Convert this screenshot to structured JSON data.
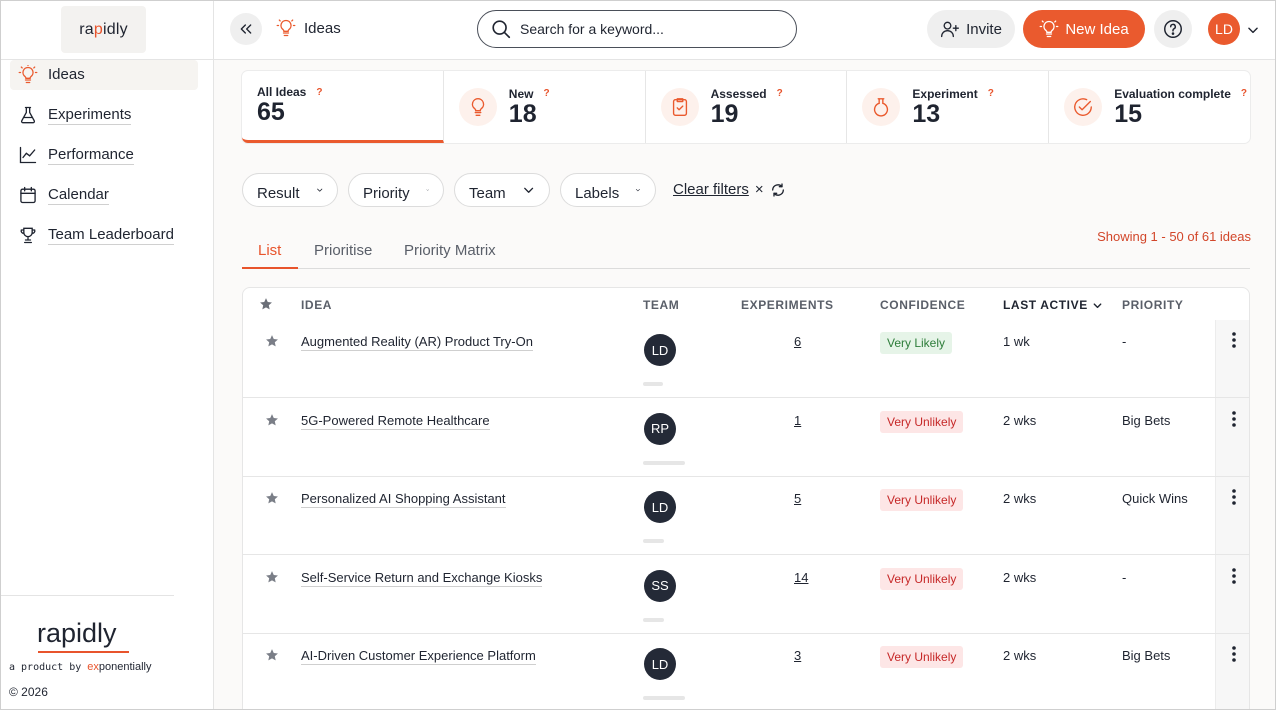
{
  "sidebar": {
    "logo": {
      "pre": "ra",
      "hl": "p",
      "post": "idly"
    },
    "items": [
      {
        "label": "Ideas",
        "icon": "lightbulb-icon"
      },
      {
        "label": "Experiments",
        "icon": "flask-icon"
      },
      {
        "label": "Performance",
        "icon": "line-chart-icon"
      },
      {
        "label": "Calendar",
        "icon": "calendar-icon"
      },
      {
        "label": "Team Leaderboard",
        "icon": "trophy-icon"
      }
    ],
    "footer": {
      "brand": "rapidly",
      "sub_prefix": "a product by",
      "sub_brand_ex": "ex",
      "sub_brand_rest": "ponentially",
      "copyright": "© 2026"
    }
  },
  "header": {
    "crumb": "Ideas",
    "search_placeholder": "Search for a keyword...",
    "invite_label": "Invite",
    "new_idea_label": "New Idea",
    "avatar": "LD"
  },
  "stats": [
    {
      "name": "All Ideas",
      "value": "65",
      "icon": "none"
    },
    {
      "name": "New",
      "value": "18",
      "icon": "lightbulb-icon"
    },
    {
      "name": "Assessed",
      "value": "19",
      "icon": "clipboard-check-icon"
    },
    {
      "name": "Experiment",
      "value": "13",
      "icon": "flask-icon"
    },
    {
      "name": "Evaluation complete",
      "value": "15",
      "icon": "check-circle-icon"
    }
  ],
  "stat_help": "?",
  "filters": [
    "Result",
    "Priority",
    "Team",
    "Labels"
  ],
  "clear_filters": "Clear filters",
  "clear_x": "×",
  "tabs": [
    "List",
    "Prioritise",
    "Priority Matrix"
  ],
  "showing": "Showing 1 - 50 of 61 ideas",
  "table": {
    "headers": {
      "idea": "IDEA",
      "team": "TEAM",
      "experiments": "EXPERIMENTS",
      "confidence": "CONFIDENCE",
      "last_active": "LAST ACTIVE",
      "priority": "PRIORITY"
    },
    "rows": [
      {
        "idea": "Augmented Reality (AR) Product Try-On",
        "team": "LD",
        "experiments": "6",
        "confidence": "Very Likely",
        "last_active": "1 wk",
        "priority": "-"
      },
      {
        "idea": "5G-Powered Remote Healthcare",
        "team": "RP",
        "experiments": "1",
        "confidence": "Very Unlikely",
        "last_active": "2 wks",
        "priority": "Big Bets"
      },
      {
        "idea": "Personalized AI Shopping Assistant",
        "team": "LD",
        "experiments": "5",
        "confidence": "Very Unlikely",
        "last_active": "2 wks",
        "priority": "Quick Wins"
      },
      {
        "idea": "Self-Service Return and Exchange Kiosks",
        "team": "SS",
        "experiments": "14",
        "confidence": "Very Unlikely",
        "last_active": "2 wks",
        "priority": "-"
      },
      {
        "idea": "AI-Driven Customer Experience Platform",
        "team": "LD",
        "experiments": "3",
        "confidence": "Very Unlikely",
        "last_active": "2 wks",
        "priority": "Big Bets"
      }
    ]
  },
  "colors": {
    "accent": "#ea5a2e",
    "likely_bg": "#e6f4e8",
    "likely_fg": "#2e7d3a",
    "unlikely_bg": "#fde6e6",
    "unlikely_fg": "#c62828"
  }
}
